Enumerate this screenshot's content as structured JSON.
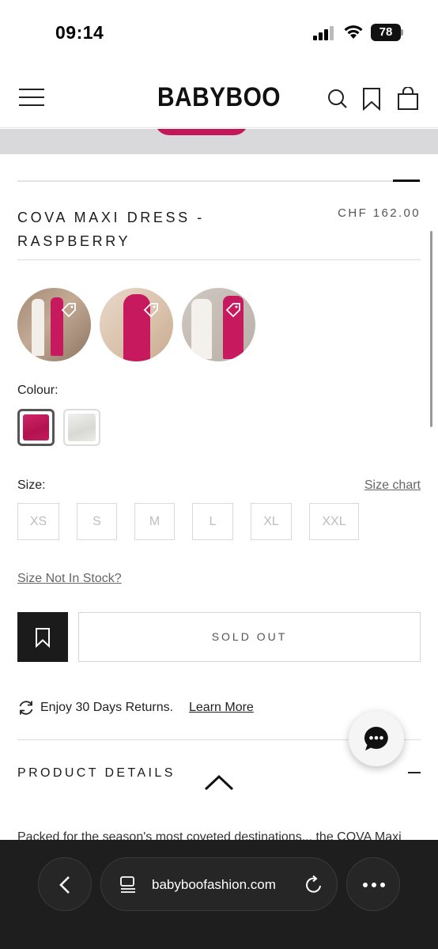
{
  "status_bar": {
    "time": "09:14",
    "battery": "78"
  },
  "header": {
    "logo": "BABYBOO"
  },
  "product": {
    "title": "COVA MAXI DRESS - RASPBERRY",
    "price": "CHF 162.00"
  },
  "colour": {
    "label": "Colour:",
    "options": [
      "raspberry",
      "white"
    ]
  },
  "size": {
    "label": "Size:",
    "chart_link": "Size chart",
    "options": [
      "XS",
      "S",
      "M",
      "L",
      "XL",
      "XXL"
    ],
    "not_in_stock": "Size Not In Stock?"
  },
  "actions": {
    "sold_out": "SOLD OUT"
  },
  "returns": {
    "text": "Enjoy 30 Days Returns.",
    "link": "Learn More"
  },
  "details": {
    "title": "PRODUCT DETAILS",
    "partial_text": "Packed for the season's most coveted destinations... the COVA Maxi"
  },
  "browser": {
    "url": "babyboofashion.com"
  },
  "colors": {
    "accent": "#c4175a",
    "dark": "#1b1b1b"
  }
}
